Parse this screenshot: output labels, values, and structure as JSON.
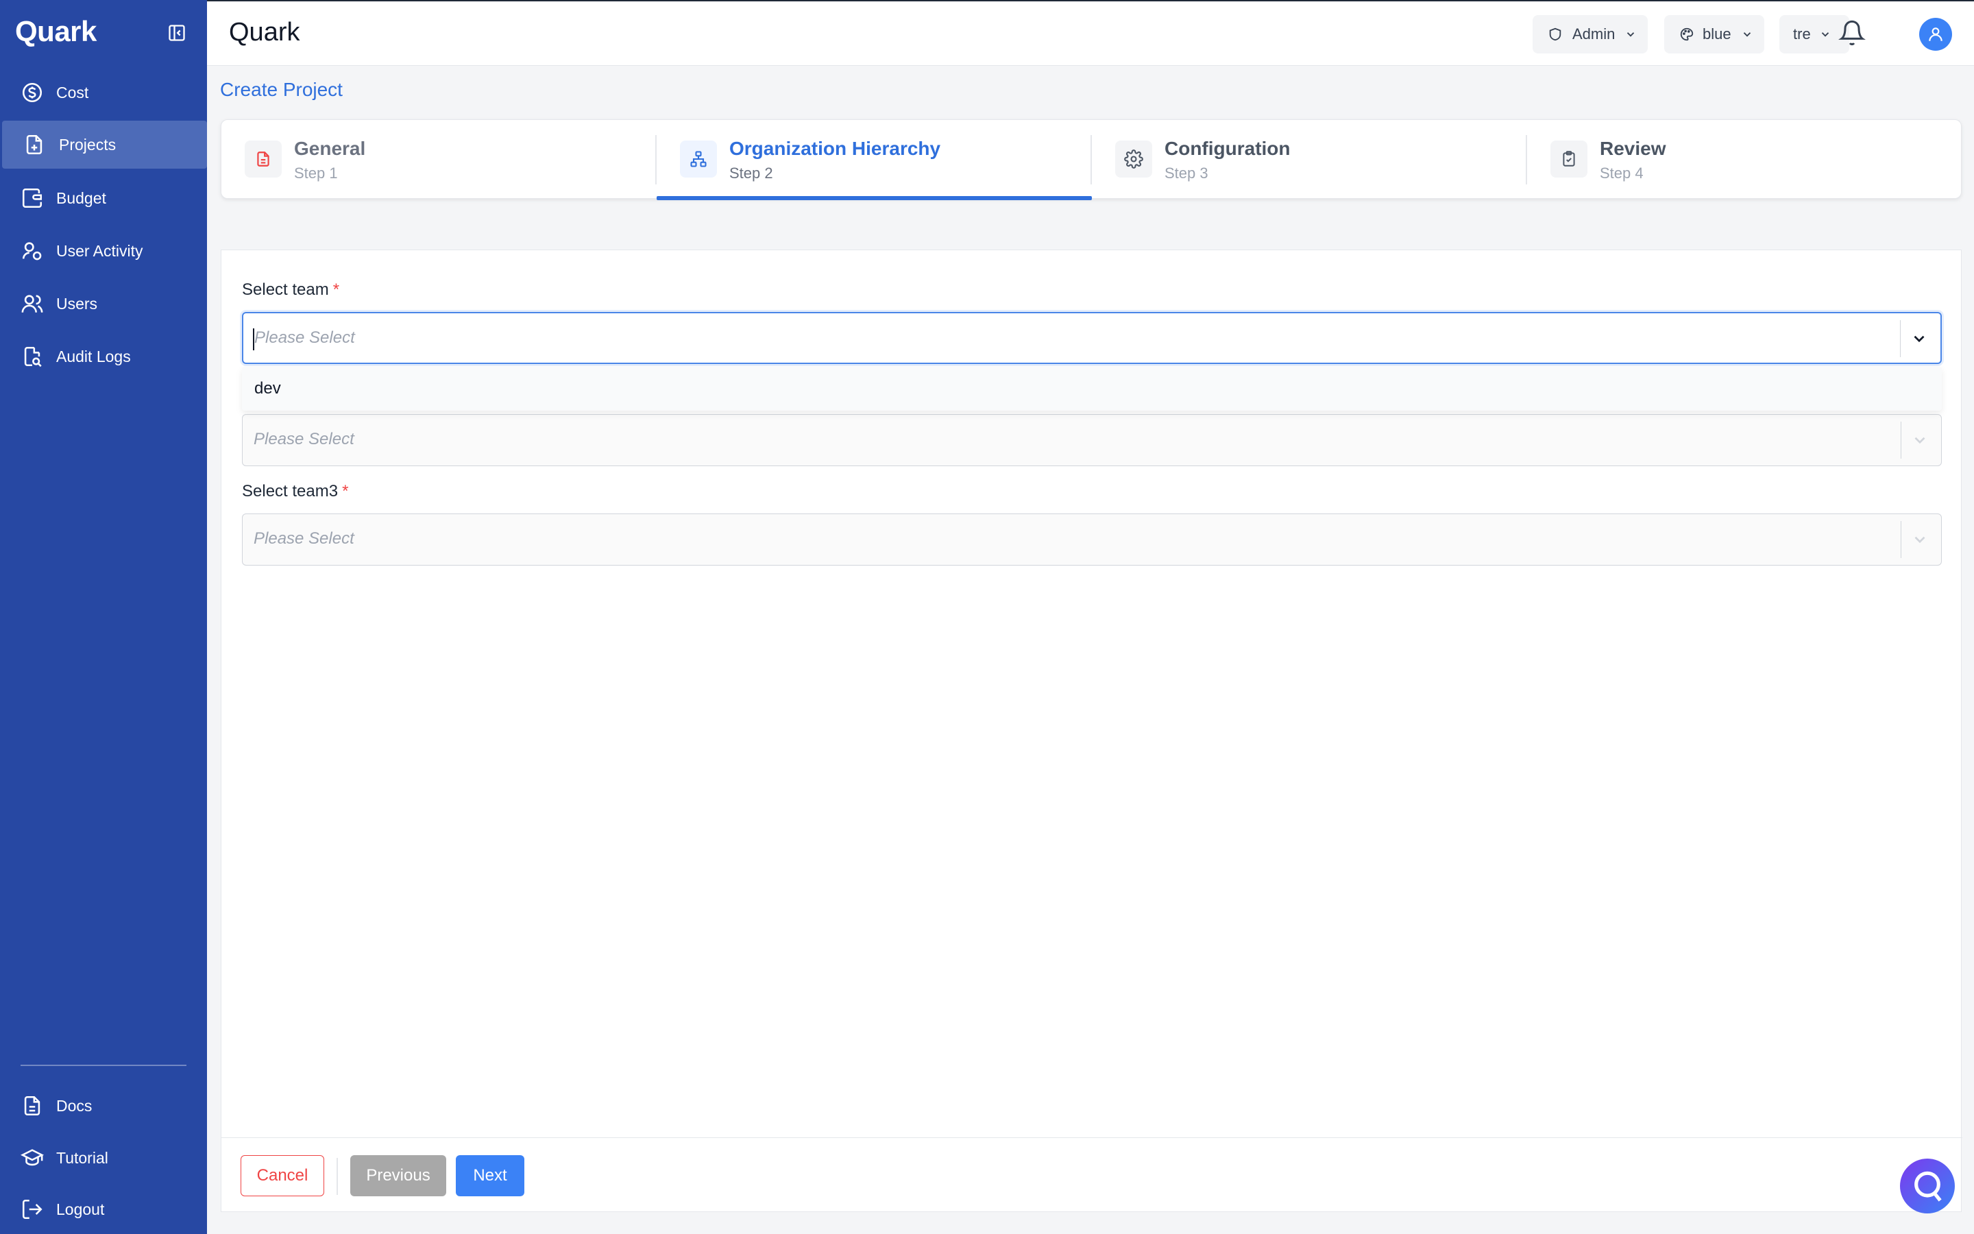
{
  "app": {
    "name": "Quark"
  },
  "sidebar": {
    "logo": "Quark",
    "items": [
      {
        "label": "Cost",
        "icon": "dollar-circle-icon"
      },
      {
        "label": "Projects",
        "icon": "file-plus-icon",
        "active": true
      },
      {
        "label": "Budget",
        "icon": "wallet-icon"
      },
      {
        "label": "User Activity",
        "icon": "user-activity-icon"
      },
      {
        "label": "Users",
        "icon": "users-icon"
      },
      {
        "label": "Audit Logs",
        "icon": "file-search-icon"
      }
    ],
    "bottom_items": [
      {
        "label": "Docs",
        "icon": "document-icon"
      },
      {
        "label": "Tutorial",
        "icon": "graduation-cap-icon"
      },
      {
        "label": "Logout",
        "icon": "logout-icon"
      }
    ]
  },
  "header": {
    "title": "Quark",
    "role": "Admin",
    "theme": "blue",
    "workspace": "tre"
  },
  "page": {
    "title": "Create Project"
  },
  "stepper": {
    "steps": [
      {
        "title": "General",
        "sub": "Step 1"
      },
      {
        "title": "Organization Hierarchy",
        "sub": "Step 2",
        "active": true
      },
      {
        "title": "Configuration",
        "sub": "Step 3"
      },
      {
        "title": "Review",
        "sub": "Step 4"
      }
    ]
  },
  "form": {
    "team_label": "Select team",
    "team3_label": "Select team3",
    "required_mark": "*",
    "placeholder": "Please Select",
    "dropdown_options": [
      "dev"
    ]
  },
  "footer": {
    "cancel": "Cancel",
    "previous": "Previous",
    "next": "Next"
  },
  "colors": {
    "sidebar": "#2748a3",
    "accent": "#2f6fdc",
    "danger": "#ef4444"
  }
}
